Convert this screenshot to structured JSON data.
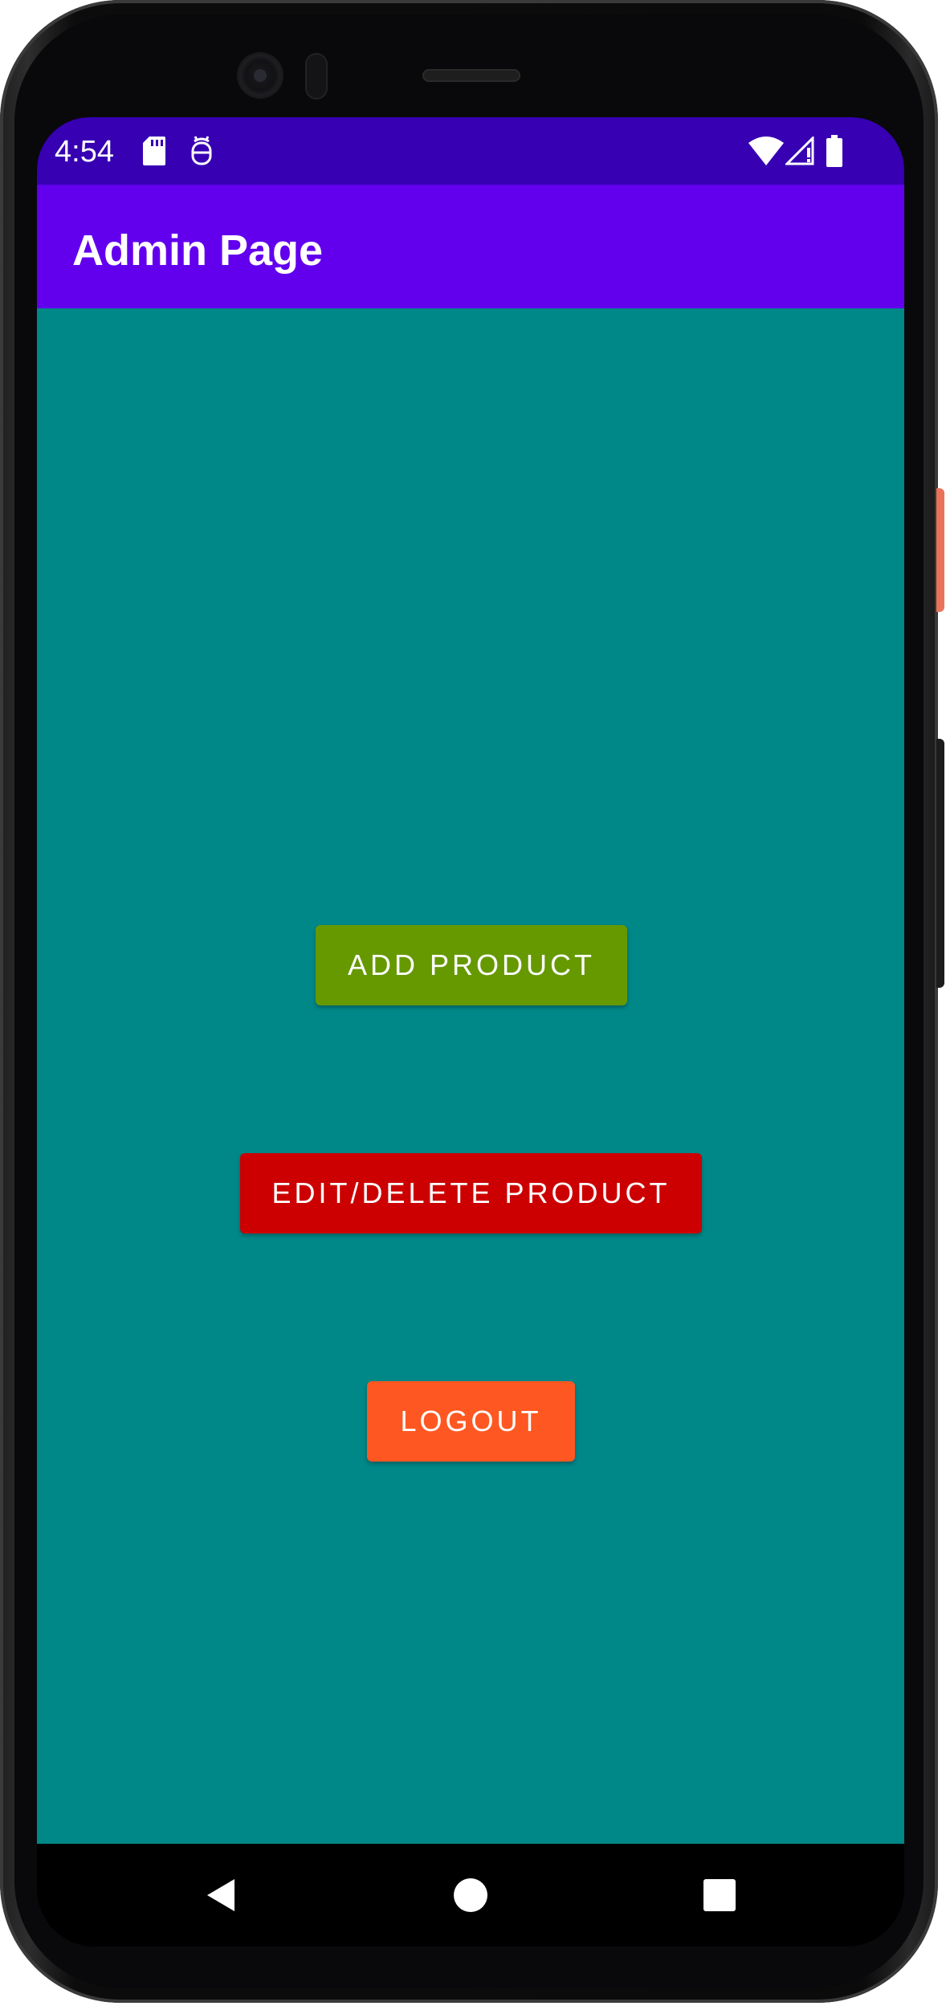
{
  "status_bar": {
    "time": "4:54",
    "left_icons": [
      "sd-card-icon",
      "debug-icon"
    ],
    "right_icons": [
      "wifi-icon",
      "signal-icon",
      "battery-icon"
    ],
    "color": "#3700b3"
  },
  "app_bar": {
    "title": "Admin Page",
    "color": "#6200ee"
  },
  "content": {
    "background": "#008787",
    "buttons": {
      "add_product": {
        "label": "ADD PRODUCT",
        "color": "#669900"
      },
      "edit_delete_product": {
        "label": "EDIT/DELETE PRODUCT",
        "color": "#cc0000"
      },
      "logout": {
        "label": "LOGOUT",
        "color": "#ff5722"
      }
    }
  },
  "nav_bar": {
    "items": [
      "back-icon",
      "home-icon",
      "recents-icon"
    ]
  }
}
